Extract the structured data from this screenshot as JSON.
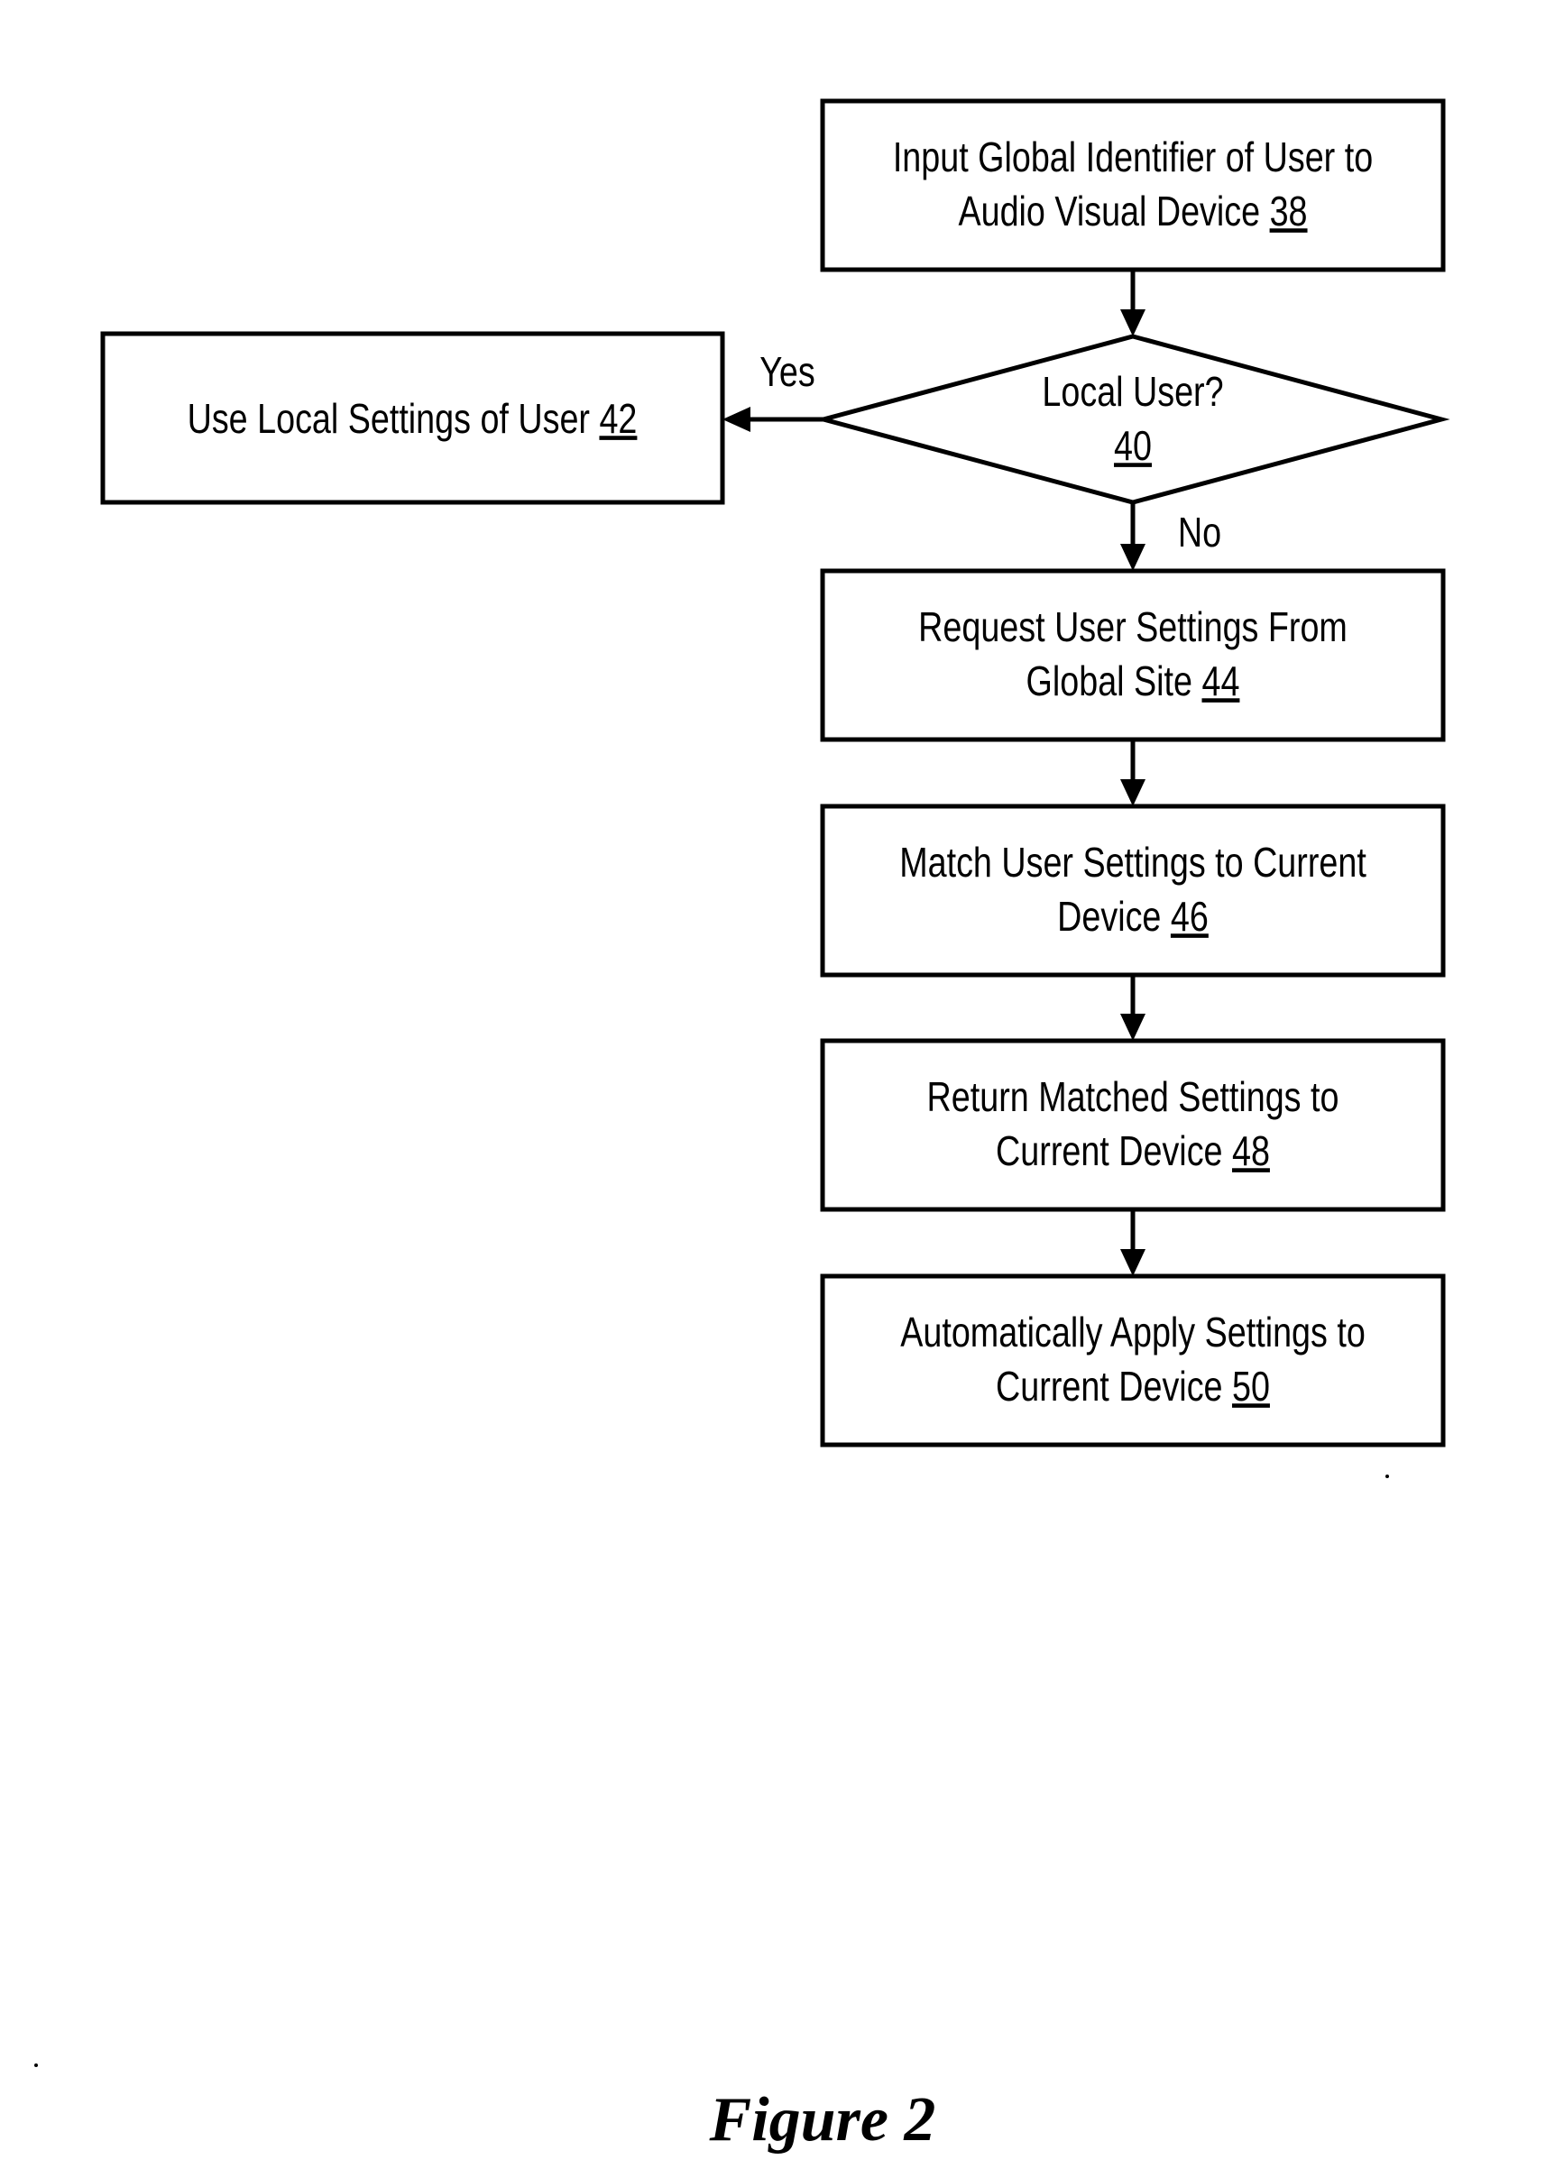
{
  "figure": {
    "caption": "Figure 2",
    "nodes": [
      {
        "id": "38",
        "type": "process",
        "lines": [
          "Input Global Identifier of User to",
          "Audio Visual Device"
        ],
        "ref": "38"
      },
      {
        "id": "40",
        "type": "decision",
        "lines": [
          "Local User?"
        ],
        "ref": "40"
      },
      {
        "id": "42",
        "type": "process",
        "lines": [
          "Use Local Settings of User"
        ],
        "ref": "42"
      },
      {
        "id": "44",
        "type": "process",
        "lines": [
          "Request User Settings From",
          "Global Site"
        ],
        "ref": "44"
      },
      {
        "id": "46",
        "type": "process",
        "lines": [
          "Match User Settings to Current",
          "Device"
        ],
        "ref": "46"
      },
      {
        "id": "48",
        "type": "process",
        "lines": [
          "Return Matched Settings to",
          "Current Device"
        ],
        "ref": "48"
      },
      {
        "id": "50",
        "type": "process",
        "lines": [
          "Automatically Apply Settings to",
          "Current Device"
        ],
        "ref": "50"
      }
    ],
    "edges": [
      {
        "from": "38",
        "to": "40",
        "label": ""
      },
      {
        "from": "40",
        "to": "42",
        "label": "Yes"
      },
      {
        "from": "40",
        "to": "44",
        "label": "No"
      },
      {
        "from": "44",
        "to": "46",
        "label": ""
      },
      {
        "from": "46",
        "to": "48",
        "label": ""
      },
      {
        "from": "48",
        "to": "50",
        "label": ""
      }
    ]
  }
}
